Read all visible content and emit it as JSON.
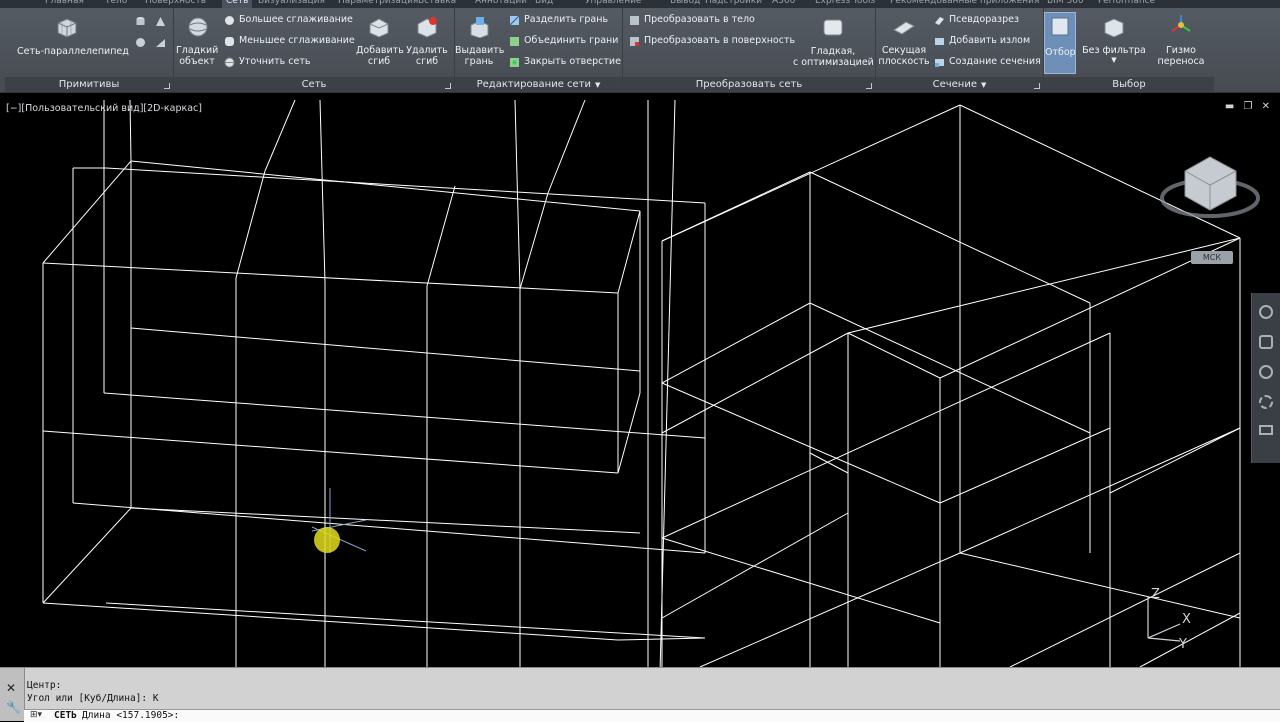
{
  "ribbon": {
    "tabs": [
      {
        "label": "Главная"
      },
      {
        "label": "Тело"
      },
      {
        "label": "Поверхность"
      },
      {
        "label": "Сеть",
        "active": true
      },
      {
        "label": "Визуализация"
      },
      {
        "label": "Параметризация"
      },
      {
        "label": "Вставка"
      },
      {
        "label": "Аннотации"
      },
      {
        "label": "Вид"
      },
      {
        "label": "Управление"
      },
      {
        "label": "Вывод"
      },
      {
        "label": "Надстройки"
      },
      {
        "label": "A360"
      },
      {
        "label": "Express Tools"
      },
      {
        "label": "Рекомендованные приложения"
      },
      {
        "label": "BIM 360"
      },
      {
        "label": "Performance"
      }
    ],
    "primitives": {
      "title": "Примитивы",
      "box_label": "Сеть-параллелепипед"
    },
    "mesh": {
      "title": "Сеть",
      "smooth_object_label": "Гладкий\nобъект",
      "more_smooth": "Большее сглаживание",
      "less_smooth": "Меньшее сглаживание",
      "refine": "Уточнить сеть",
      "add_crease": "Добавить\nсгиб",
      "remove_crease": "Удалить\nсгиб"
    },
    "mesh_edit": {
      "title": "Редактирование сети",
      "extrude_face": "Выдавить\nгрань",
      "split_face": "Разделить грань",
      "merge_faces": "Объединить грани",
      "close_hole": "Закрыть отверстие"
    },
    "convert": {
      "title": "Преобразовать сеть",
      "to_solid": "Преобразовать в тело",
      "to_surface": "Преобразовать в поверхность",
      "smooth_optimized": "Гладкая,\nс оптимизацией"
    },
    "section": {
      "title": "Сечение",
      "section_plane": "Секущая\nплоскость",
      "pseudo_section": "Псевдоразрез",
      "add_jog": "Добавить излом",
      "create_section": "Создание сечения"
    },
    "selection": {
      "title": "Выбор",
      "culling": "Отбор",
      "no_filter": "Без фильтра",
      "move_gizmo": "Гизмо\nпереноса"
    }
  },
  "viewport": {
    "label": "[−][Пользовательский вид][2D-каркас]",
    "win_controls": [
      "▬",
      "❐",
      "✕"
    ],
    "viewcube_badge": "МСК",
    "ucs": {
      "z": "Z",
      "x": "X",
      "y": "Y"
    },
    "colors": {
      "wire": "#ffffff",
      "cursor": "#e0dc1c"
    }
  },
  "command": {
    "history": [
      "Центр:",
      "Угол или [Куб/Длина]: К"
    ],
    "current_cmd": "СЕТЬ",
    "prompt": "Длина <157.1905>:"
  }
}
